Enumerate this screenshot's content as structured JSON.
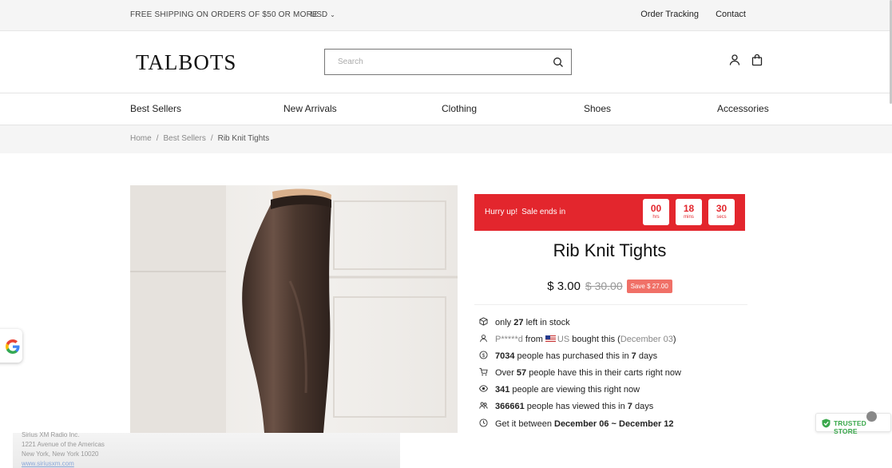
{
  "topbar": {
    "shipping_text": "FREE SHIPPING ON ORDERS OF $50 OR MORE",
    "currency": "USD",
    "links": [
      "Order Tracking",
      "Contact"
    ]
  },
  "header": {
    "logo": "TALBOTS",
    "search_placeholder": "Search"
  },
  "nav": [
    "Best Sellers",
    "New Arrivals",
    "Clothing",
    "Shoes",
    "Accessories"
  ],
  "breadcrumb": [
    "Home",
    "Best Sellers",
    "Rib Knit Tights"
  ],
  "sale_banner": {
    "hurry": "Hurry up!",
    "ends": "Sale ends in",
    "countdown": [
      {
        "value": "00",
        "unit": "hrs"
      },
      {
        "value": "18",
        "unit": "mins"
      },
      {
        "value": "30",
        "unit": "secs"
      }
    ],
    "color": "#e3262d"
  },
  "product": {
    "title": "Rib Knit Tights",
    "price": "$ 3.00",
    "compare_price": "$ 30.00",
    "save_badge": "Save $ 27.00"
  },
  "info_rows": {
    "stock": {
      "pre": "only",
      "num": "27",
      "post": "left in stock"
    },
    "purchase": {
      "buyer": "P*****d",
      "from": "from",
      "country": "US",
      "bought": "bought this (",
      "date": "December 03",
      "close": ")"
    },
    "purchased": {
      "num": "7034",
      "mid": "people has purchased this in",
      "days": "7",
      "post": "days"
    },
    "carts": {
      "pre": "Over",
      "num": "57",
      "post": "people have this in their carts right now"
    },
    "viewing": {
      "num": "341",
      "post": "people are viewing this right now"
    },
    "viewed": {
      "num": "366661",
      "mid": "people has viewed this in",
      "days": "7",
      "post": "days"
    },
    "delivery": {
      "pre": "Get it between",
      "range": "December 06 ~ December 12"
    }
  },
  "footer_overlay": {
    "lines": [
      "Sirius XM Radio Inc.",
      "1221 Avenue of the Americas",
      "New York, New York 10020"
    ],
    "link": "www.siriusxm.com"
  },
  "trusted_badge": "TRUSTED STORE"
}
